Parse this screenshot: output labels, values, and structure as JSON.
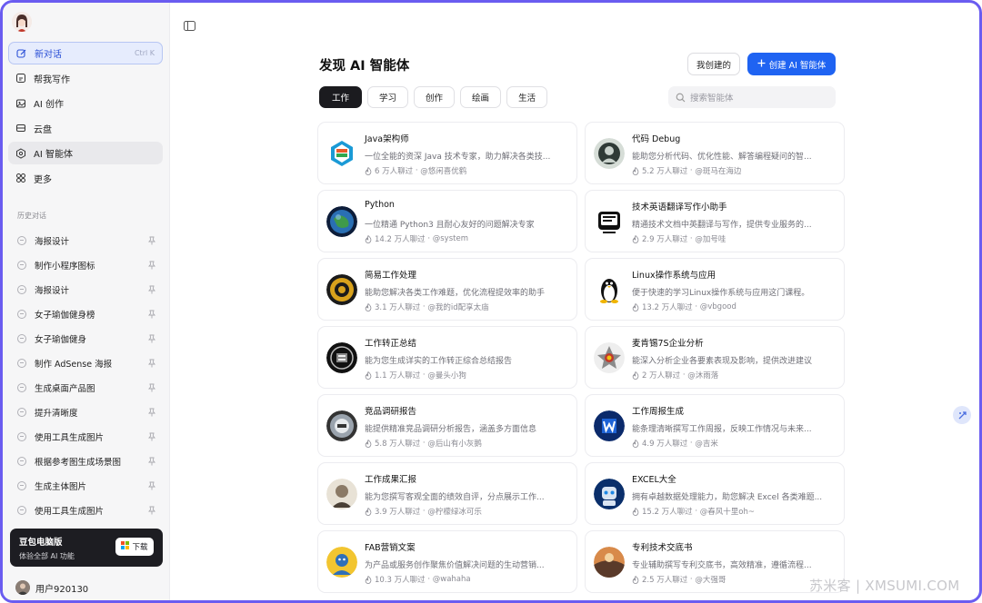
{
  "sidebar": {
    "nav": [
      {
        "label": "新对话",
        "shortcut": "Ctrl K",
        "icon": "compose-icon"
      },
      {
        "label": "帮我写作",
        "icon": "pen-icon"
      },
      {
        "label": "AI 创作",
        "icon": "image-icon"
      },
      {
        "label": "云盘",
        "icon": "cloud-drive-icon"
      },
      {
        "label": "AI 智能体",
        "icon": "agent-icon"
      },
      {
        "label": "更多",
        "icon": "grid-icon"
      }
    ],
    "history_title": "历史对话",
    "history": [
      "海报设计",
      "制作小程序图标",
      "海报设计",
      "女子瑜伽健身榜",
      "女子瑜伽健身",
      "制作 AdSense 海报",
      "生成桌面产品图",
      "提升清晰度",
      "使用工具生成图片",
      "根据参考图生成场景图",
      "生成主体图片",
      "使用工具生成图片"
    ],
    "promo": {
      "title": "豆包电脑版",
      "subtitle": "体验全部 AI 功能",
      "download": "下载"
    },
    "user": "用户920130"
  },
  "main": {
    "title": "发现 AI 智能体",
    "mine_label": "我创建的",
    "create_label": "创建 AI 智能体",
    "tabs": [
      "工作",
      "学习",
      "创作",
      "绘画",
      "生活"
    ],
    "active_tab": "工作",
    "search_placeholder": "搜索智能体",
    "cards": [
      {
        "name": "Java架构师",
        "desc": "一位全能的资深 Java 技术专家，助力解决各类技...",
        "users": "6 万人聊过",
        "author": "@悠闲喜优鹤"
      },
      {
        "name": "代码 Debug",
        "desc": "能助您分析代码、优化性能、解答编程疑问的智...",
        "users": "5.2 万人聊过",
        "author": "@斑马在海边"
      },
      {
        "name": "Python",
        "desc": "一位精通 Python3 且耐心友好的问题解决专家",
        "users": "14.2 万人聊过",
        "author": "@system"
      },
      {
        "name": "技术英语翻译写作小助手",
        "desc": "精通技术文档中英翻译与写作，提供专业服务的...",
        "users": "2.9 万人聊过",
        "author": "@加号哇"
      },
      {
        "name": "简易工作处理",
        "desc": "能助您解决各类工作难题，优化流程提效率的助手",
        "users": "3.1 万人聊过",
        "author": "@我的id配享太庙"
      },
      {
        "name": "Linux操作系统与应用",
        "desc": "便于快速的学习Linux操作系统与应用这门课程。",
        "users": "13.2 万人聊过",
        "author": "@vbgood"
      },
      {
        "name": "工作转正总结",
        "desc": "能为您生成详实的工作转正综合总结报告",
        "users": "1.1 万人聊过",
        "author": "@曼头小狗"
      },
      {
        "name": "麦肯锡7S企业分析",
        "desc": "能深入分析企业各要素表现及影响，提供改进建议",
        "users": "2 万人聊过",
        "author": "@沐雨落"
      },
      {
        "name": "竞品调研报告",
        "desc": "能提供精准竞品调研分析报告，涵盖多方面信息",
        "users": "5.8 万人聊过",
        "author": "@后山有小灰鹅"
      },
      {
        "name": "工作周报生成",
        "desc": "能条理清晰撰写工作周报，反映工作情况与未来...",
        "users": "4.9 万人聊过",
        "author": "@吉米"
      },
      {
        "name": "工作成果汇报",
        "desc": "能为您撰写客观全面的绩效自评，分点展示工作...",
        "users": "3.9 万人聊过",
        "author": "@柠檬绿冰可乐"
      },
      {
        "name": "EXCEL大全",
        "desc": "拥有卓越数据处理能力，助您解决 Excel 各类难题...",
        "users": "15.2 万人聊过",
        "author": "@春风十里oh~"
      },
      {
        "name": "FAB营销文案",
        "desc": "为产品或服务创作聚焦价值解决问题的生动营销...",
        "users": "10.3 万人聊过",
        "author": "@wahaha"
      },
      {
        "name": "专利技术交底书",
        "desc": "专业辅助撰写专利交底书，高效精准，遵循流程...",
        "users": "2.5 万人聊过",
        "author": "@大强哥"
      }
    ]
  },
  "watermark": "苏米客 | XMSUMI.COM",
  "colors": {
    "accent": "#1f63f2",
    "frame": "#6a5cf0",
    "promo_bg": "#1d1d22"
  }
}
